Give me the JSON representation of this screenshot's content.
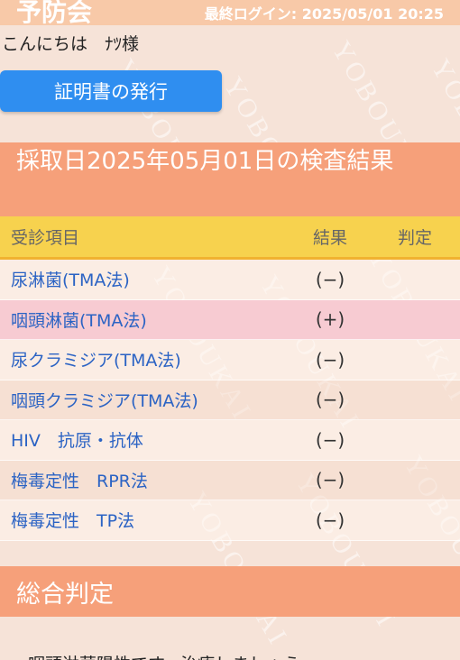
{
  "header": {
    "brand": "予防会",
    "last_login_label": "最終ログイン:",
    "last_login_value": "2025/05/01 20:25"
  },
  "greeting": "こんにちは　ﾅﾂ様",
  "certificate_button": "証明書の発行",
  "result_section": {
    "title": "採取日2025年05月01日の検査結果"
  },
  "table": {
    "headers": {
      "item": "受診項目",
      "result": "結果",
      "judgement": "判定"
    },
    "rows": [
      {
        "item": "尿淋菌(TMA法)",
        "result": "(−)",
        "judgement": ""
      },
      {
        "item": "咽頭淋菌(TMA法)",
        "result": "(+)",
        "judgement": ""
      },
      {
        "item": "尿クラミジア(TMA法)",
        "result": "(−)",
        "judgement": ""
      },
      {
        "item": "咽頭クラミジア(TMA法)",
        "result": "(−)",
        "judgement": ""
      },
      {
        "item": "HIV　抗原・抗体",
        "result": "(−)",
        "judgement": ""
      },
      {
        "item": "梅毒定性　RPR法",
        "result": "(−)",
        "judgement": ""
      },
      {
        "item": "梅毒定性　TP法",
        "result": "(−)",
        "judgement": ""
      }
    ]
  },
  "summary": {
    "title": "総合判定",
    "text": "・咽頭淋菌陽性です。治療しましょう。"
  },
  "watermark_text": "YOBOUKAI",
  "colors": {
    "background": "#f6e3d8",
    "section_header": "#f6a07a",
    "table_header": "#f7d24e",
    "button": "#2f8ef0",
    "item_text": "#2b63c4",
    "positive_row": "#f7cbd2"
  }
}
